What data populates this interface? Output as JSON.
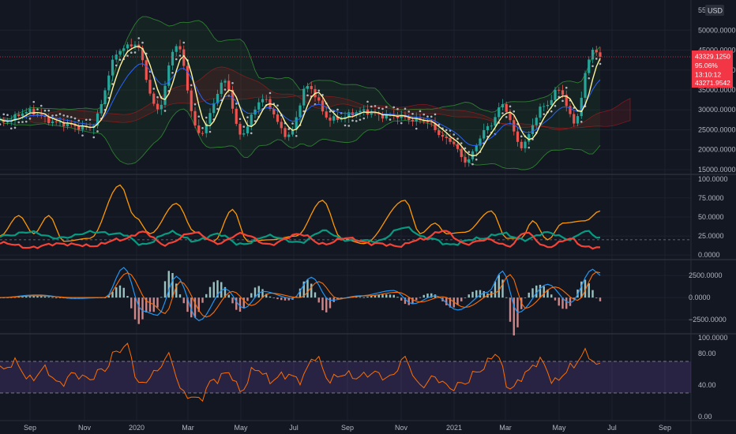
{
  "currency_label": "USD",
  "colors": {
    "background": "#131722",
    "grid": "#1e222d",
    "divider": "#2a2e39",
    "axis_text": "#b2b5be",
    "up": "#26a69a",
    "down": "#ef5350",
    "price_badge": "#f23645",
    "sma": "#fff59d",
    "ema": "#2962ff",
    "bollinger": "#2e7d32",
    "psar": "#b2b5be",
    "adx": "#ff9800",
    "di_plus": "#089981",
    "di_minus": "#f44336",
    "macd": "#2196f3",
    "signal": "#ff6d00",
    "rsi": "#ff6d00",
    "rsi_band": "#7e57c2"
  },
  "price_tag": {
    "price": "43329.1250",
    "percent": "95.06%",
    "countdown": "13:10:12",
    "secondary": "43271.9542"
  },
  "chart_data": [
    {
      "type": "line",
      "panel": "price",
      "y_ticks": [
        "50000.0000",
        "45000.0000",
        "40000.0000",
        "35000.0000",
        "30000.0000",
        "25000.0000",
        "20000.0000",
        "15000.0000"
      ],
      "y_tick_values": [
        50000,
        45000,
        40000,
        35000,
        30000,
        25000,
        20000,
        15000
      ],
      "top_label_partial": "55",
      "ylim": [
        14000,
        56000
      ],
      "x_labels": [
        "Sep",
        "Nov",
        "2020",
        "Mar",
        "May",
        "Jul",
        "Sep",
        "Nov",
        "2021",
        "Mar",
        "May",
        "Jul",
        "Sep"
      ],
      "last_price": 43329.125,
      "series_anchors": [
        {
          "x": 0,
          "y": 27000
        },
        {
          "x": 8,
          "y": 29500
        },
        {
          "x": 16,
          "y": 26500
        },
        {
          "x": 24,
          "y": 25500
        },
        {
          "x": 32,
          "y": 45000
        },
        {
          "x": 36,
          "y": 46500
        },
        {
          "x": 42,
          "y": 30000
        },
        {
          "x": 47,
          "y": 46500
        },
        {
          "x": 53,
          "y": 24000
        },
        {
          "x": 60,
          "y": 37000
        },
        {
          "x": 64,
          "y": 24000
        },
        {
          "x": 70,
          "y": 32500
        },
        {
          "x": 77,
          "y": 23500
        },
        {
          "x": 82,
          "y": 36000
        },
        {
          "x": 88,
          "y": 27500
        },
        {
          "x": 96,
          "y": 29500
        },
        {
          "x": 104,
          "y": 28500
        },
        {
          "x": 112,
          "y": 27500
        },
        {
          "x": 120,
          "y": 22500
        },
        {
          "x": 124,
          "y": 17000
        },
        {
          "x": 130,
          "y": 25500
        },
        {
          "x": 134,
          "y": 31000
        },
        {
          "x": 139,
          "y": 21000
        },
        {
          "x": 145,
          "y": 31000
        },
        {
          "x": 149,
          "y": 35000
        },
        {
          "x": 153,
          "y": 27000
        },
        {
          "x": 158,
          "y": 45000
        },
        {
          "x": 160,
          "y": 43300
        }
      ]
    },
    {
      "type": "line",
      "panel": "adx",
      "y_ticks": [
        "100.0000",
        "75.0000",
        "50.0000",
        "25.0000",
        "0.0000"
      ],
      "y_tick_values": [
        100,
        75,
        50,
        25,
        0
      ],
      "ylim": [
        -5,
        105
      ],
      "dashed_level": 20,
      "series": [
        {
          "name": "ADX",
          "anchors": [
            {
              "x": 0,
              "y": 25
            },
            {
              "x": 5,
              "y": 52
            },
            {
              "x": 9,
              "y": 28
            },
            {
              "x": 13,
              "y": 52
            },
            {
              "x": 17,
              "y": 18
            },
            {
              "x": 24,
              "y": 22
            },
            {
              "x": 32,
              "y": 92
            },
            {
              "x": 36,
              "y": 50
            },
            {
              "x": 40,
              "y": 28
            },
            {
              "x": 47,
              "y": 68
            },
            {
              "x": 52,
              "y": 30
            },
            {
              "x": 57,
              "y": 18
            },
            {
              "x": 62,
              "y": 60
            },
            {
              "x": 66,
              "y": 18
            },
            {
              "x": 72,
              "y": 20
            },
            {
              "x": 79,
              "y": 25
            },
            {
              "x": 86,
              "y": 72
            },
            {
              "x": 91,
              "y": 22
            },
            {
              "x": 97,
              "y": 15
            },
            {
              "x": 108,
              "y": 72
            },
            {
              "x": 112,
              "y": 28
            },
            {
              "x": 116,
              "y": 42
            },
            {
              "x": 119,
              "y": 28
            },
            {
              "x": 124,
              "y": 30
            },
            {
              "x": 131,
              "y": 58
            },
            {
              "x": 135,
              "y": 22
            },
            {
              "x": 139,
              "y": 22
            },
            {
              "x": 142,
              "y": 45
            },
            {
              "x": 146,
              "y": 20
            },
            {
              "x": 150,
              "y": 42
            },
            {
              "x": 156,
              "y": 45
            },
            {
              "x": 160,
              "y": 58
            }
          ]
        },
        {
          "name": "+DI",
          "anchors": [
            {
              "x": 0,
              "y": 25
            },
            {
              "x": 8,
              "y": 30
            },
            {
              "x": 16,
              "y": 22
            },
            {
              "x": 24,
              "y": 30
            },
            {
              "x": 32,
              "y": 28
            },
            {
              "x": 38,
              "y": 14
            },
            {
              "x": 46,
              "y": 30
            },
            {
              "x": 52,
              "y": 18
            },
            {
              "x": 58,
              "y": 28
            },
            {
              "x": 64,
              "y": 14
            },
            {
              "x": 72,
              "y": 25
            },
            {
              "x": 80,
              "y": 16
            },
            {
              "x": 86,
              "y": 32
            },
            {
              "x": 92,
              "y": 20
            },
            {
              "x": 100,
              "y": 18
            },
            {
              "x": 108,
              "y": 36
            },
            {
              "x": 114,
              "y": 22
            },
            {
              "x": 120,
              "y": 14
            },
            {
              "x": 128,
              "y": 22
            },
            {
              "x": 134,
              "y": 28
            },
            {
              "x": 140,
              "y": 20
            },
            {
              "x": 146,
              "y": 30
            },
            {
              "x": 152,
              "y": 20
            },
            {
              "x": 156,
              "y": 32
            },
            {
              "x": 160,
              "y": 22
            }
          ]
        },
        {
          "name": "-DI",
          "anchors": [
            {
              "x": 0,
              "y": 16
            },
            {
              "x": 8,
              "y": 10
            },
            {
              "x": 16,
              "y": 15
            },
            {
              "x": 24,
              "y": 12
            },
            {
              "x": 32,
              "y": 20
            },
            {
              "x": 38,
              "y": 30
            },
            {
              "x": 44,
              "y": 14
            },
            {
              "x": 52,
              "y": 30
            },
            {
              "x": 58,
              "y": 15
            },
            {
              "x": 64,
              "y": 28
            },
            {
              "x": 72,
              "y": 14
            },
            {
              "x": 80,
              "y": 28
            },
            {
              "x": 86,
              "y": 14
            },
            {
              "x": 92,
              "y": 22
            },
            {
              "x": 100,
              "y": 15
            },
            {
              "x": 106,
              "y": 12
            },
            {
              "x": 112,
              "y": 20
            },
            {
              "x": 118,
              "y": 32
            },
            {
              "x": 124,
              "y": 15
            },
            {
              "x": 130,
              "y": 20
            },
            {
              "x": 136,
              "y": 12
            },
            {
              "x": 140,
              "y": 30
            },
            {
              "x": 146,
              "y": 10
            },
            {
              "x": 152,
              "y": 22
            },
            {
              "x": 156,
              "y": 10
            },
            {
              "x": 160,
              "y": 10
            }
          ]
        }
      ]
    },
    {
      "type": "line",
      "panel": "macd",
      "y_ticks": [
        "2500.0000",
        "0.0000",
        "−2500.0000"
      ],
      "y_tick_values": [
        2500,
        0,
        -2500
      ],
      "ylim": [
        -4000,
        4200
      ],
      "series": [
        {
          "name": "MACD",
          "anchors": [
            {
              "x": 0,
              "y": 0
            },
            {
              "x": 10,
              "y": 300
            },
            {
              "x": 20,
              "y": -100
            },
            {
              "x": 28,
              "y": 0
            },
            {
              "x": 33,
              "y": 3400
            },
            {
              "x": 38,
              "y": -1500
            },
            {
              "x": 42,
              "y": -2000
            },
            {
              "x": 47,
              "y": 2400
            },
            {
              "x": 53,
              "y": -2600
            },
            {
              "x": 60,
              "y": 1000
            },
            {
              "x": 65,
              "y": -1200
            },
            {
              "x": 70,
              "y": 700
            },
            {
              "x": 78,
              "y": -100
            },
            {
              "x": 83,
              "y": 2300
            },
            {
              "x": 88,
              "y": -300
            },
            {
              "x": 96,
              "y": 200
            },
            {
              "x": 105,
              "y": 800
            },
            {
              "x": 110,
              "y": -700
            },
            {
              "x": 116,
              "y": 200
            },
            {
              "x": 122,
              "y": -1400
            },
            {
              "x": 130,
              "y": 600
            },
            {
              "x": 134,
              "y": 3000
            },
            {
              "x": 138,
              "y": -1700
            },
            {
              "x": 146,
              "y": 1500
            },
            {
              "x": 152,
              "y": -600
            },
            {
              "x": 158,
              "y": 3200
            },
            {
              "x": 160,
              "y": 2500
            }
          ]
        },
        {
          "name": "Signal",
          "anchors": [
            {
              "x": 0,
              "y": 0
            },
            {
              "x": 10,
              "y": 200
            },
            {
              "x": 20,
              "y": 0
            },
            {
              "x": 28,
              "y": 0
            },
            {
              "x": 34,
              "y": 2800
            },
            {
              "x": 40,
              "y": -600
            },
            {
              "x": 44,
              "y": -1800
            },
            {
              "x": 48,
              "y": 1800
            },
            {
              "x": 55,
              "y": -2200
            },
            {
              "x": 62,
              "y": 700
            },
            {
              "x": 67,
              "y": -900
            },
            {
              "x": 72,
              "y": 500
            },
            {
              "x": 80,
              "y": 0
            },
            {
              "x": 85,
              "y": 1800
            },
            {
              "x": 90,
              "y": -100
            },
            {
              "x": 98,
              "y": 200
            },
            {
              "x": 106,
              "y": 600
            },
            {
              "x": 112,
              "y": -500
            },
            {
              "x": 118,
              "y": 100
            },
            {
              "x": 124,
              "y": -1100
            },
            {
              "x": 132,
              "y": 500
            },
            {
              "x": 136,
              "y": 2600
            },
            {
              "x": 140,
              "y": -1200
            },
            {
              "x": 148,
              "y": 1200
            },
            {
              "x": 154,
              "y": -300
            },
            {
              "x": 159,
              "y": 2900
            },
            {
              "x": 160,
              "y": 2800
            }
          ]
        }
      ]
    },
    {
      "type": "line",
      "panel": "rsi",
      "y_ticks": [
        "100.0000",
        "80.00",
        "40.00",
        "0.00"
      ],
      "y_tick_values": [
        100,
        80,
        40,
        0
      ],
      "ylim": [
        -4,
        104
      ],
      "band": [
        30,
        70
      ],
      "series": [
        {
          "name": "RSI",
          "anchors": [
            {
              "x": 0,
              "y": 58
            },
            {
              "x": 4,
              "y": 70
            },
            {
              "x": 8,
              "y": 45
            },
            {
              "x": 12,
              "y": 62
            },
            {
              "x": 16,
              "y": 40
            },
            {
              "x": 20,
              "y": 55
            },
            {
              "x": 24,
              "y": 48
            },
            {
              "x": 28,
              "y": 60
            },
            {
              "x": 31,
              "y": 85
            },
            {
              "x": 34,
              "y": 88
            },
            {
              "x": 37,
              "y": 40
            },
            {
              "x": 41,
              "y": 55
            },
            {
              "x": 45,
              "y": 75
            },
            {
              "x": 49,
              "y": 30
            },
            {
              "x": 53,
              "y": 20
            },
            {
              "x": 57,
              "y": 48
            },
            {
              "x": 61,
              "y": 55
            },
            {
              "x": 64,
              "y": 32
            },
            {
              "x": 68,
              "y": 62
            },
            {
              "x": 72,
              "y": 45
            },
            {
              "x": 76,
              "y": 55
            },
            {
              "x": 80,
              "y": 45
            },
            {
              "x": 84,
              "y": 78
            },
            {
              "x": 88,
              "y": 45
            },
            {
              "x": 92,
              "y": 55
            },
            {
              "x": 96,
              "y": 50
            },
            {
              "x": 100,
              "y": 55
            },
            {
              "x": 104,
              "y": 50
            },
            {
              "x": 108,
              "y": 72
            },
            {
              "x": 112,
              "y": 40
            },
            {
              "x": 116,
              "y": 48
            },
            {
              "x": 120,
              "y": 38
            },
            {
              "x": 124,
              "y": 42
            },
            {
              "x": 128,
              "y": 60
            },
            {
              "x": 132,
              "y": 80
            },
            {
              "x": 136,
              "y": 35
            },
            {
              "x": 140,
              "y": 55
            },
            {
              "x": 144,
              "y": 70
            },
            {
              "x": 148,
              "y": 45
            },
            {
              "x": 152,
              "y": 60
            },
            {
              "x": 156,
              "y": 82
            },
            {
              "x": 160,
              "y": 62
            }
          ]
        }
      ]
    }
  ]
}
